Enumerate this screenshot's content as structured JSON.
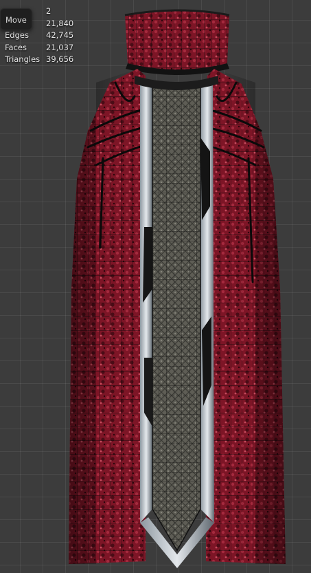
{
  "tooltip": {
    "label": "Move"
  },
  "stats": [
    {
      "label": "",
      "value": "2"
    },
    {
      "label": "",
      "value": "21,840"
    },
    {
      "label": "Edges",
      "value": "42,745"
    },
    {
      "label": "Faces",
      "value": "21,037"
    },
    {
      "label": "Triangles",
      "value": "39,656"
    }
  ],
  "colors": {
    "viewport_bg": "#3c3c3c",
    "robe_red": "#8a1a2a",
    "panel_gray": "#6b6b63",
    "wire": "#0d0d0d"
  }
}
